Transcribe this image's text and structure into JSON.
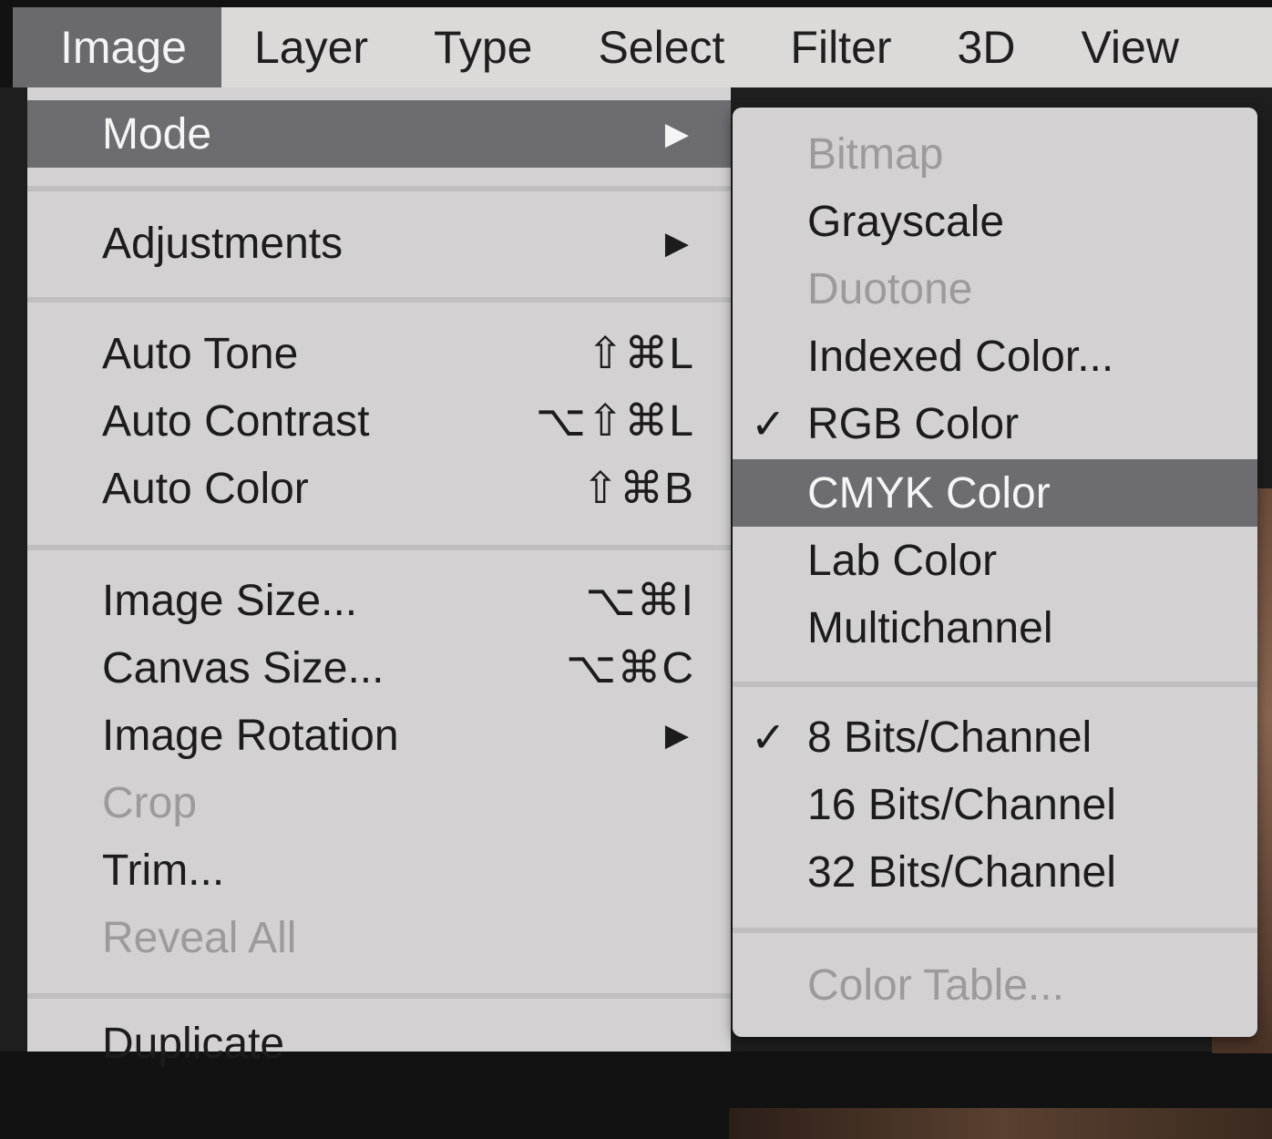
{
  "menubar": {
    "items": [
      {
        "label": "Image"
      },
      {
        "label": "Layer"
      },
      {
        "label": "Type"
      },
      {
        "label": "Select"
      },
      {
        "label": "Filter"
      },
      {
        "label": "3D"
      },
      {
        "label": "View"
      }
    ]
  },
  "image_menu": {
    "mode": {
      "label": "Mode",
      "arrow": "▶"
    },
    "adjustments": {
      "label": "Adjustments",
      "arrow": "▶"
    },
    "auto_tone": {
      "label": "Auto Tone",
      "shortcut": "⇧⌘L"
    },
    "auto_contrast": {
      "label": "Auto Contrast",
      "shortcut": "⌥⇧⌘L"
    },
    "auto_color": {
      "label": "Auto Color",
      "shortcut": "⇧⌘B"
    },
    "image_size": {
      "label": "Image Size...",
      "shortcut": "⌥⌘I"
    },
    "canvas_size": {
      "label": "Canvas Size...",
      "shortcut": "⌥⌘C"
    },
    "image_rotation": {
      "label": "Image Rotation",
      "arrow": "▶"
    },
    "crop": {
      "label": "Crop"
    },
    "trim": {
      "label": "Trim..."
    },
    "reveal_all": {
      "label": "Reveal All"
    },
    "duplicate": {
      "label": "Duplicate"
    }
  },
  "mode_submenu": {
    "bitmap": {
      "label": "Bitmap"
    },
    "grayscale": {
      "label": "Grayscale"
    },
    "duotone": {
      "label": "Duotone"
    },
    "indexed_color": {
      "label": "Indexed Color..."
    },
    "rgb_color": {
      "label": "RGB Color",
      "check": "✓"
    },
    "cmyk_color": {
      "label": "CMYK Color"
    },
    "lab_color": {
      "label": "Lab Color"
    },
    "multichannel": {
      "label": "Multichannel"
    },
    "bits8": {
      "label": "8 Bits/Channel",
      "check": "✓"
    },
    "bits16": {
      "label": "16 Bits/Channel"
    },
    "bits32": {
      "label": "32 Bits/Channel"
    },
    "color_table": {
      "label": "Color Table..."
    }
  }
}
